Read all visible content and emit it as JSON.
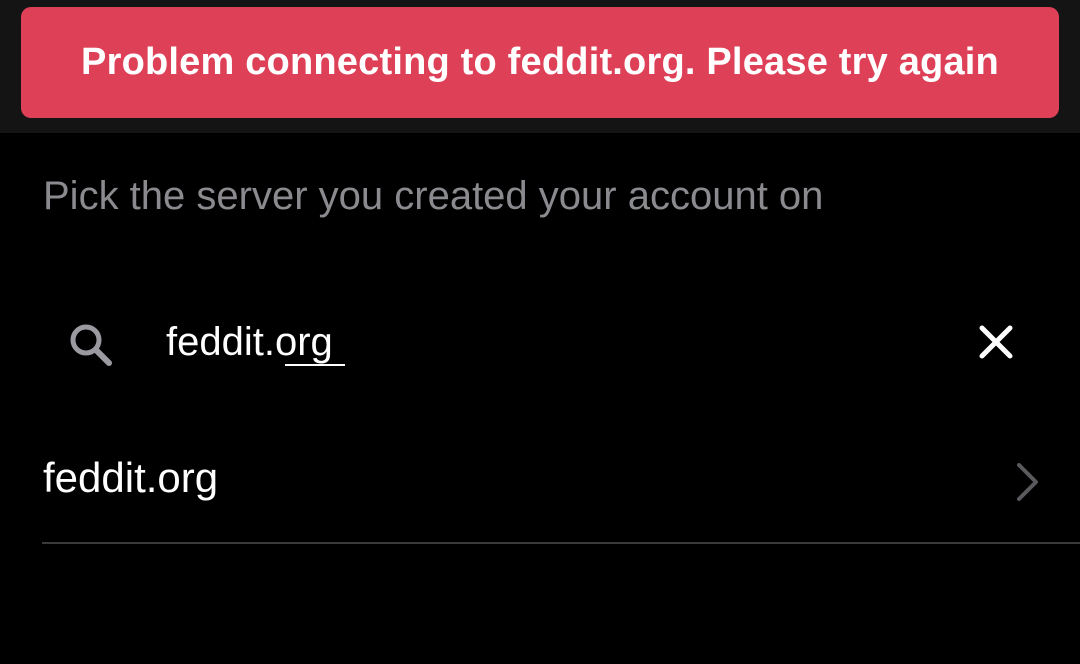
{
  "toast": {
    "message": "Problem connecting to feddit.org. Please try again",
    "color": "#de4157"
  },
  "prompt": {
    "text": "Pick the server you created your account on"
  },
  "search": {
    "value": "feddit.org",
    "icon": "search-icon",
    "clear_icon": "close-icon"
  },
  "results": [
    {
      "label": "feddit.org",
      "icon": "chevron-right-icon"
    }
  ]
}
